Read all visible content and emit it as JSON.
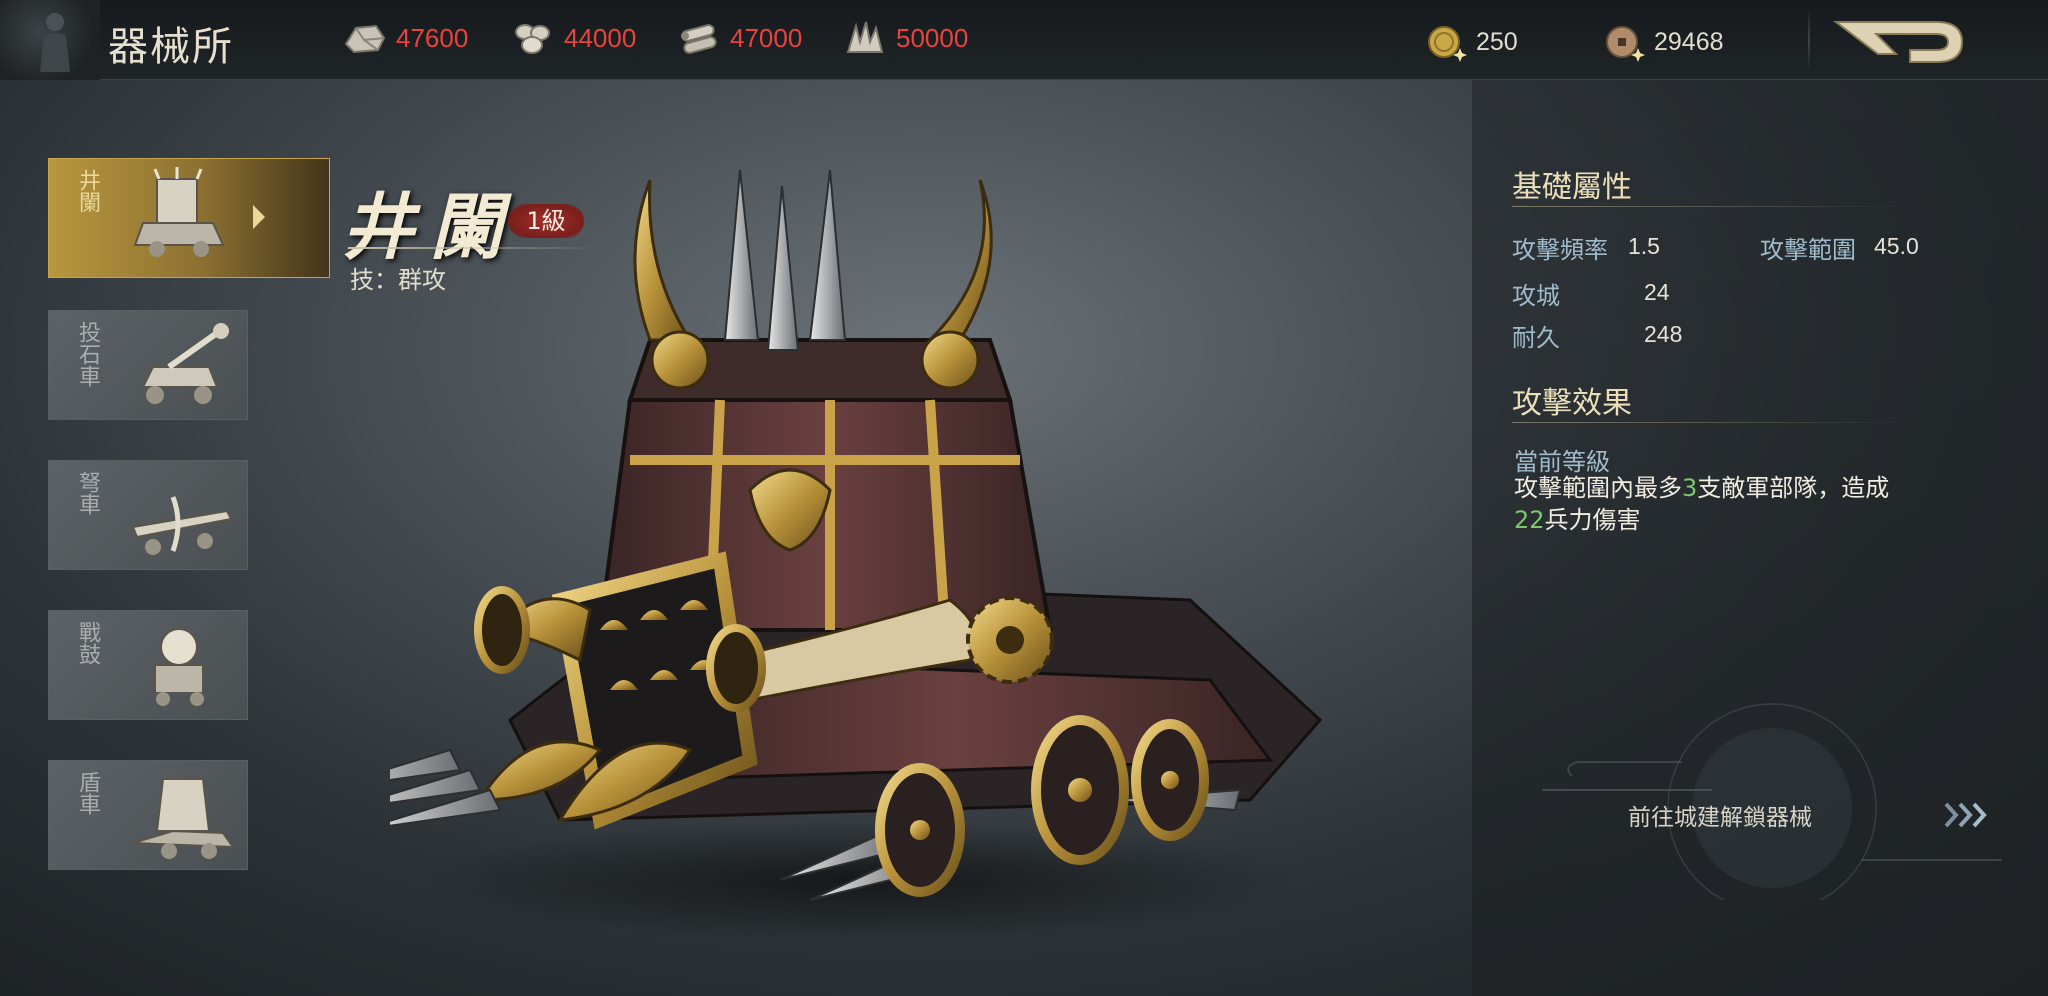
{
  "header": {
    "title": "器械所",
    "resources": [
      {
        "name": "stone",
        "icon": "stone-icon",
        "value": "47600"
      },
      {
        "name": "grain",
        "icon": "grain-icon",
        "value": "44000"
      },
      {
        "name": "wood",
        "icon": "wood-icon",
        "value": "47000"
      },
      {
        "name": "iron",
        "icon": "iron-icon",
        "value": "50000"
      }
    ],
    "currencies": [
      {
        "name": "gold",
        "icon": "gold-coin-icon",
        "value": "250"
      },
      {
        "name": "copper",
        "icon": "copper-coin-icon",
        "value": "29468"
      }
    ],
    "back_icon": "back-arrow-icon"
  },
  "units": [
    {
      "name": "井闌",
      "active": true
    },
    {
      "name": "投石車",
      "active": false
    },
    {
      "name": "弩車",
      "active": false
    },
    {
      "name": "戰鼓",
      "active": false
    },
    {
      "name": "盾車",
      "active": false
    }
  ],
  "selected": {
    "name": "井闌",
    "level": "1級",
    "skill": "技：群攻"
  },
  "base_stats": {
    "title": "基礎屬性",
    "attack_rate_label": "攻擊頻率",
    "attack_rate_value": "1.5",
    "attack_range_label": "攻擊範圍",
    "attack_range_value": "45.0",
    "siege_label": "攻城",
    "siege_value": "24",
    "durability_label": "耐久",
    "durability_value": "248"
  },
  "effect": {
    "title": "攻擊效果",
    "current_level_label": "當前等級",
    "text_part1": "攻擊範圍內最多",
    "num_targets": "3",
    "text_part2": "支敵軍部隊，造成",
    "num_damage": "22",
    "text_part3": "兵力傷害"
  },
  "unlock": {
    "label": "前往城建解鎖器械"
  },
  "colors": {
    "resource_value": "#e8433e",
    "gold_accent": "#c7a54e",
    "highlight_number": "#7dc86b",
    "stat_label": "#9fbccc"
  }
}
